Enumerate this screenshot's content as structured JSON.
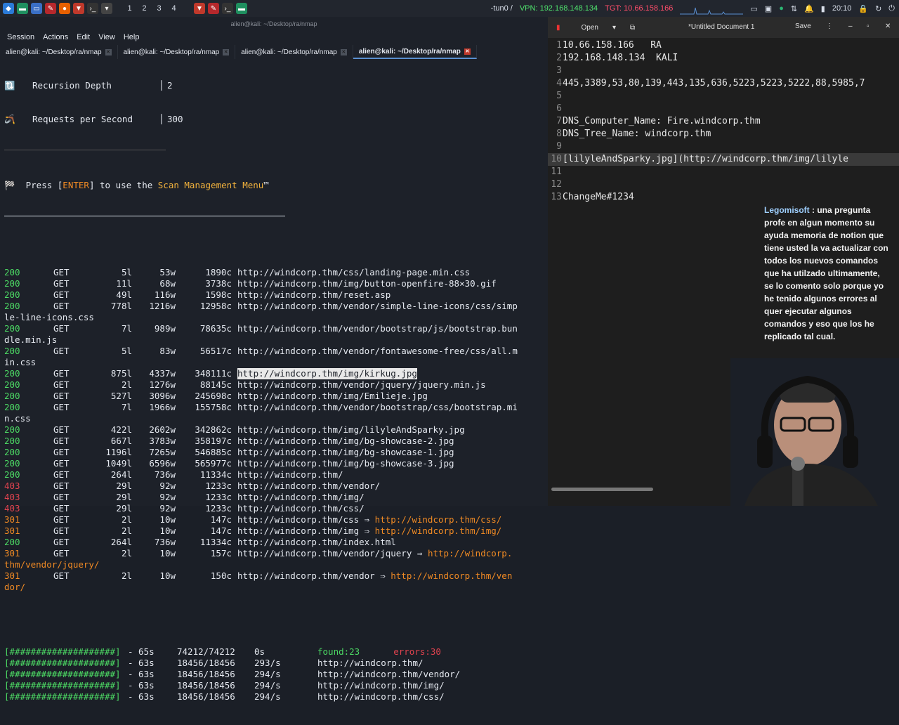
{
  "topbar": {
    "workspaces": [
      "1",
      "2",
      "3",
      "4"
    ],
    "tun_label": "-tun0 /",
    "vpn_label": "VPN: 192.168.148.134",
    "tgt_label": "TGT: 10.66.158.166",
    "clock": "20:10",
    "colors": {
      "vpn": "#4fe36d",
      "tgt": "#ff4d6a"
    }
  },
  "terminal": {
    "window_title": "alien@kali: ~/Desktop/ra/nmap",
    "menu": [
      "Session",
      "Actions",
      "Edit",
      "View",
      "Help"
    ],
    "tabs": [
      {
        "label": "alien@kali: ~/Desktop/ra/nmap",
        "active": false
      },
      {
        "label": "alien@kali: ~/Desktop/ra/nmap",
        "active": false
      },
      {
        "label": "alien@kali: ~/Desktop/ra/nmap",
        "active": false
      },
      {
        "label": "alien@kali: ~/Desktop/ra/nmap",
        "active": true
      }
    ],
    "config": [
      {
        "icon": "🔃",
        "label": "Recursion Depth",
        "value": "2"
      },
      {
        "icon": "🪃",
        "label": "Requests per Second",
        "value": "300"
      }
    ],
    "press_prefix": "🏁  Press [",
    "press_key": "ENTER",
    "press_mid": "] to use the ",
    "press_menu": "Scan Management Menu",
    "press_tm": "™",
    "results": [
      {
        "status": "200",
        "method": "GET",
        "lines": "5l",
        "words": "53w",
        "chars": "1890c",
        "url": "http://windcorp.thm/css/landing-page.min.css"
      },
      {
        "status": "200",
        "method": "GET",
        "lines": "11l",
        "words": "68w",
        "chars": "3738c",
        "url": "http://windcorp.thm/img/button-openfire-88×30.gif"
      },
      {
        "status": "200",
        "method": "GET",
        "lines": "49l",
        "words": "116w",
        "chars": "1598c",
        "url": "http://windcorp.thm/reset.asp"
      },
      {
        "status": "200",
        "method": "GET",
        "lines": "778l",
        "words": "1216w",
        "chars": "12958c",
        "url": "http://windcorp.thm/vendor/simple-line-icons/css/simp",
        "wrap": "le-line-icons.css"
      },
      {
        "status": "200",
        "method": "GET",
        "lines": "7l",
        "words": "989w",
        "chars": "78635c",
        "url": "http://windcorp.thm/vendor/bootstrap/js/bootstrap.bun",
        "wrap": "dle.min.js"
      },
      {
        "status": "200",
        "method": "GET",
        "lines": "5l",
        "words": "83w",
        "chars": "56517c",
        "url": "http://windcorp.thm/vendor/fontawesome-free/css/all.m",
        "wrap": "in.css"
      },
      {
        "status": "200",
        "method": "GET",
        "lines": "875l",
        "words": "4337w",
        "chars": "348111c",
        "url": "http://windcorp.thm/img/kirkug.jpg",
        "highlight": true
      },
      {
        "status": "200",
        "method": "GET",
        "lines": "2l",
        "words": "1276w",
        "chars": "88145c",
        "url": "http://windcorp.thm/vendor/jquery/jquery.min.js"
      },
      {
        "status": "200",
        "method": "GET",
        "lines": "527l",
        "words": "3096w",
        "chars": "245698c",
        "url": "http://windcorp.thm/img/Emilieje.jpg"
      },
      {
        "status": "200",
        "method": "GET",
        "lines": "7l",
        "words": "1966w",
        "chars": "155758c",
        "url": "http://windcorp.thm/vendor/bootstrap/css/bootstrap.mi",
        "wrap": "n.css"
      },
      {
        "status": "200",
        "method": "GET",
        "lines": "422l",
        "words": "2602w",
        "chars": "342862c",
        "url": "http://windcorp.thm/img/lilyleAndSparky.jpg"
      },
      {
        "status": "200",
        "method": "GET",
        "lines": "667l",
        "words": "3783w",
        "chars": "358197c",
        "url": "http://windcorp.thm/img/bg-showcase-2.jpg"
      },
      {
        "status": "200",
        "method": "GET",
        "lines": "1196l",
        "words": "7265w",
        "chars": "546885c",
        "url": "http://windcorp.thm/img/bg-showcase-1.jpg"
      },
      {
        "status": "200",
        "method": "GET",
        "lines": "1049l",
        "words": "6596w",
        "chars": "565977c",
        "url": "http://windcorp.thm/img/bg-showcase-3.jpg"
      },
      {
        "status": "200",
        "method": "GET",
        "lines": "264l",
        "words": "736w",
        "chars": "11334c",
        "url": "http://windcorp.thm/"
      },
      {
        "status": "403",
        "method": "GET",
        "lines": "29l",
        "words": "92w",
        "chars": "1233c",
        "url": "http://windcorp.thm/vendor/"
      },
      {
        "status": "403",
        "method": "GET",
        "lines": "29l",
        "words": "92w",
        "chars": "1233c",
        "url": "http://windcorp.thm/img/"
      },
      {
        "status": "403",
        "method": "GET",
        "lines": "29l",
        "words": "92w",
        "chars": "1233c",
        "url": "http://windcorp.thm/css/"
      },
      {
        "status": "301",
        "method": "GET",
        "lines": "2l",
        "words": "10w",
        "chars": "147c",
        "url": "http://windcorp.thm/css ⇒ ",
        "redirect": "http://windcorp.thm/css/"
      },
      {
        "status": "301",
        "method": "GET",
        "lines": "2l",
        "words": "10w",
        "chars": "147c",
        "url": "http://windcorp.thm/img ⇒ ",
        "redirect": "http://windcorp.thm/img/"
      },
      {
        "status": "200",
        "method": "GET",
        "lines": "264l",
        "words": "736w",
        "chars": "11334c",
        "url": "http://windcorp.thm/index.html"
      },
      {
        "status": "301",
        "method": "GET",
        "lines": "2l",
        "words": "10w",
        "chars": "157c",
        "url": "http://windcorp.thm/vendor/jquery ⇒ ",
        "redirect": "http://windcorp.",
        "wrap": "thm/vendor/jquery/",
        "wrap_color": "orange"
      },
      {
        "status": "301",
        "method": "GET",
        "lines": "2l",
        "words": "10w",
        "chars": "150c",
        "url": "http://windcorp.thm/vendor ⇒ ",
        "redirect": "http://windcorp.thm/ven",
        "wrap": "dor/",
        "wrap_color": "orange"
      }
    ],
    "progress": [
      {
        "bar": "[####################]",
        "time": "- 65s",
        "count": "74212/74212",
        "rate": "0s",
        "target": "found:23",
        "errors": "errors:30"
      },
      {
        "bar": "[####################]",
        "time": "- 63s",
        "count": "18456/18456",
        "rate": "293/s",
        "target": "http://windcorp.thm/"
      },
      {
        "bar": "[####################]",
        "time": "- 63s",
        "count": "18456/18456",
        "rate": "294/s",
        "target": "http://windcorp.thm/vendor/"
      },
      {
        "bar": "[####################]",
        "time": "- 63s",
        "count": "18456/18456",
        "rate": "294/s",
        "target": "http://windcorp.thm/img/"
      },
      {
        "bar": "[####################]",
        "time": "- 63s",
        "count": "18456/18456",
        "rate": "294/s",
        "target": "http://windcorp.thm/css/"
      }
    ]
  },
  "editor": {
    "open_label": "Open",
    "title": "*Untitled Document 1",
    "save_label": "Save",
    "lines": [
      {
        "n": "1",
        "text": "10.66.158.166   RA"
      },
      {
        "n": "2",
        "text": "192.168.148.134  KALI"
      },
      {
        "n": "3",
        "text": ""
      },
      {
        "n": "4",
        "text": "445,3389,53,80,139,443,135,636,5223,5223,5222,88,5985,7"
      },
      {
        "n": "5",
        "text": ""
      },
      {
        "n": "6",
        "text": ""
      },
      {
        "n": "7",
        "text": "DNS_Computer_Name: Fire.windcorp.thm"
      },
      {
        "n": "8",
        "text": "DNS_Tree_Name: windcorp.thm"
      },
      {
        "n": "9",
        "text": ""
      },
      {
        "n": "10",
        "text": "[lilyleAndSparky.jpg](http://windcorp.thm/img/lilyle",
        "selected": true
      },
      {
        "n": "11",
        "text": ""
      },
      {
        "n": "12",
        "text": ""
      },
      {
        "n": "13",
        "text": "ChangeMe#1234"
      }
    ]
  },
  "chat": {
    "user": "Legomisoft",
    "message": " : una pregunta profe en algun momento su ayuda memoria de notion que tiene usted la va actualizar con todos los nuevos comandos que ha utilzado ultimamente, se lo comento solo porque yo he tenido algunos errores al quer ejecutar algunos comandos y eso que los he replicado tal cual."
  }
}
